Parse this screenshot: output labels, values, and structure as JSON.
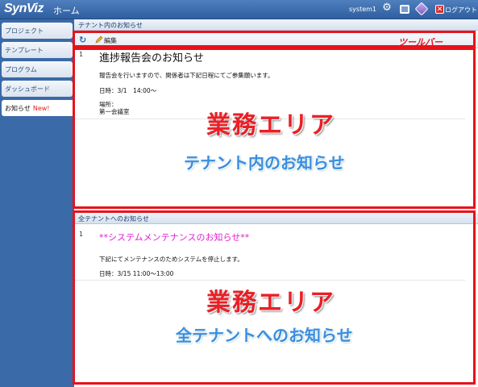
{
  "header": {
    "logo": "SynViz",
    "home": "ホーム",
    "user": "system1",
    "logout": "ログアウト",
    "icons": [
      "gear-icon",
      "window-icon",
      "layers-icon",
      "logout-icon"
    ]
  },
  "sidebar": {
    "items": [
      {
        "label": "プロジェクト"
      },
      {
        "label": "テンプレート"
      },
      {
        "label": "プログラム"
      },
      {
        "label": "ダッシュボード"
      },
      {
        "label": "お知らせ",
        "badge": "New!"
      }
    ]
  },
  "tenant_panel": {
    "title": "テナント内のお知らせ",
    "toolbar": {
      "edit_label": "編集"
    },
    "items": [
      {
        "num": "1",
        "title": "進捗報告会のお知らせ",
        "lines": [
          "報告会を行いますので、関係者は下記日程にてご参集願います。",
          "日時：3/1　14:00～",
          "場所：",
          "第一会議室"
        ]
      }
    ]
  },
  "all_panel": {
    "title": "全テナントへのお知らせ",
    "items": [
      {
        "num": "1",
        "title": "**システムメンテナンスのお知らせ**",
        "lines": [
          "下記にてメンテナンスのためシステムを停止します。",
          "日時：3/15  11:00～13:00"
        ]
      }
    ]
  },
  "annotations": {
    "toolbar": "ツールバー",
    "area1": "業務エリア",
    "area1_sub": "テナント内のお知らせ",
    "area2": "業務エリア",
    "area2_sub": "全テナントへのお知らせ"
  },
  "colors": {
    "accent_red": "#e8121a",
    "header_blue": "#3a6aa8",
    "annot_blue": "#3a8ee0",
    "magenta": "#e020d0"
  }
}
